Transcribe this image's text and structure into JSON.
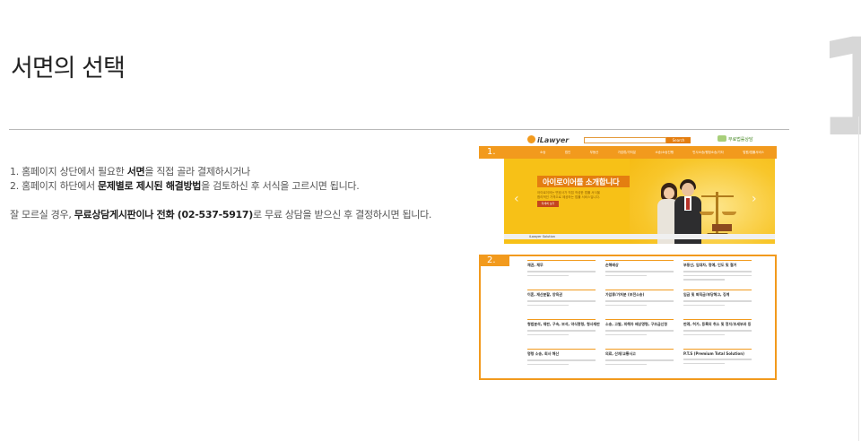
{
  "page": {
    "step_number": "1",
    "title": "서면의 선택"
  },
  "instructions": {
    "line1_pre": "1. 홈페이지 상단에서 필요한 ",
    "line1_bold": "서면",
    "line1_post": "을 직접 골라 결제하시거나",
    "line2_pre": "2. 홈페이지 하단에서 ",
    "line2_bold": "문제별로 제시된 해결방법",
    "line2_post": "을 검토하신 후 서식을 고르시면 됩니다.",
    "line3_pre": "잘 모르실 경우, ",
    "line3_bold1": "무료상담게시판이나 전화",
    "line3_bold2": " (02-537-5917)",
    "line3_post": "로 무료 상담을 받으신 후 결정하시면 됩니다."
  },
  "mockup": {
    "logo_text": "iLawyer",
    "search_button": "Search",
    "consult_link": "무료법률상담",
    "nav_items": [
      "소송",
      "법인",
      "부동산",
      "가압류/가처분",
      "소송/소송진행",
      "민사소송/행정소송/기타",
      "법원/법률서비스"
    ],
    "banner_title": "아이로이어를 소개합니다",
    "banner_copy1": "아이로이어는 변호사가 직접 작성한 법률 서식을",
    "banner_copy2": "합리적인 가격으로 제공하는 법률 서비스입니다.",
    "banner_button": "자세히 보기",
    "arrow_left": "‹",
    "arrow_right": "›",
    "solution_label": "iLawyer Solution",
    "solution_titles": [
      "채권, 채무",
      "손해배상",
      "부동산, 임대차, 명예, 인도 및 철거",
      "이혼, 재산분할, 양육권",
      "가압류/가처분 (보전소송)",
      "임금 및 퇴직금/부당해고, 징계",
      "형법분석, 재판, 구속, 보석, 약식명령, 형사재판",
      "소송, 고발, 피해자 배상명령, 구조금신청",
      "판례, 허가, 등록의 취소 및 정지/조세부과 등",
      "명령 소송, 회사 해산",
      "의료, 산재/교통사고",
      "P.T.S (Premium Total Solution)"
    ],
    "frame1_label": "1.",
    "frame2_label": "2."
  }
}
